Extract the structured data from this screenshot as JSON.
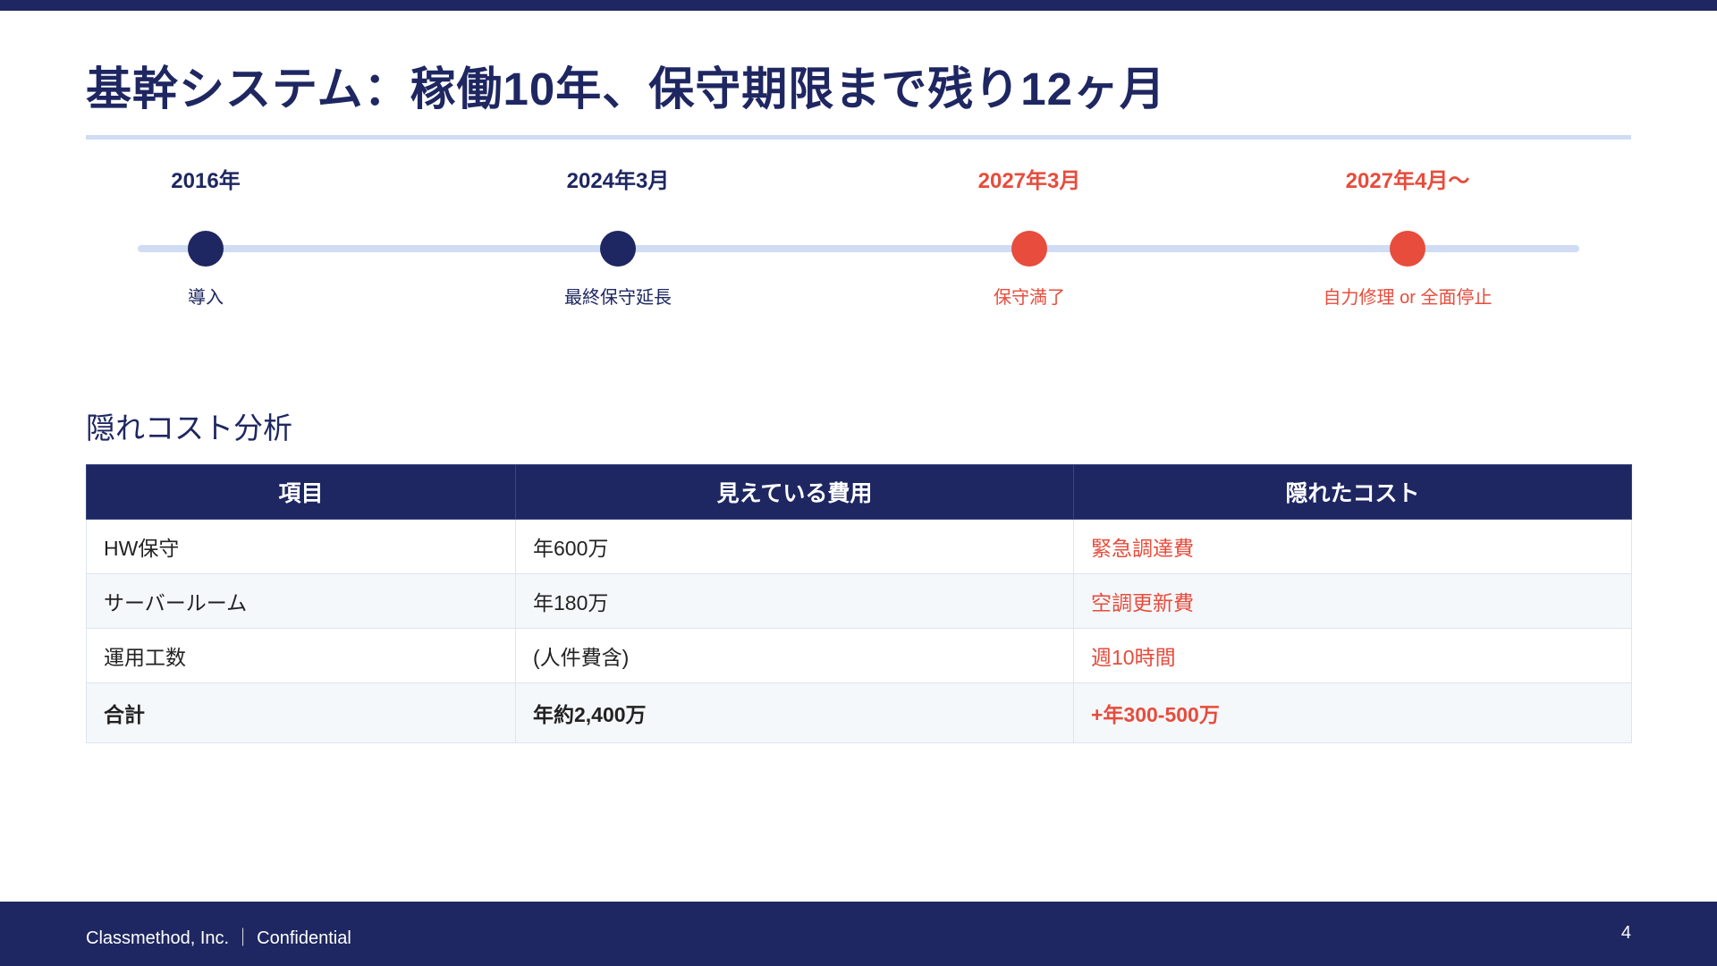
{
  "title": "基幹システム：稼働10年、保守期限まで残り12ヶ月",
  "colors": {
    "navy": "#1e2761",
    "accent_red": "#e74c3c",
    "light_blue": "#cfdcf4"
  },
  "timeline": [
    {
      "date": "2016年",
      "label": "導入",
      "color": "#1e2761"
    },
    {
      "date": "2024年3月",
      "label": "最終保守延長",
      "color": "#1e2761"
    },
    {
      "date": "2027年3月",
      "label": "保守満了",
      "color": "#e74c3c"
    },
    {
      "date": "2027年4月〜",
      "label": "自力修理 or 全面停止",
      "color": "#e74c3c"
    }
  ],
  "section_title": "隠れコスト分析",
  "table": {
    "headers": [
      "項目",
      "見えている費用",
      "隠れたコスト"
    ],
    "rows": [
      [
        "HW保守",
        "年600万",
        "緊急調達費"
      ],
      [
        "サーバールーム",
        "年180万",
        "空調更新費"
      ],
      [
        "運用工数",
        "(人件費含)",
        "週10時間"
      ]
    ],
    "total": [
      "合計",
      "年約2,400万",
      "+年300-500万"
    ]
  },
  "footer": {
    "company": "Classmethod, Inc. ｜ Confidential",
    "page": "4"
  }
}
